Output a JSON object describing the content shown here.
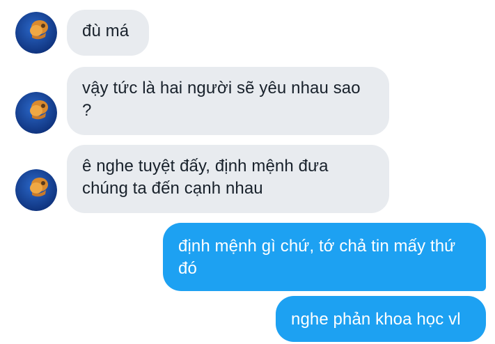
{
  "conversation": {
    "messages": [
      {
        "direction": "incoming",
        "text": "đù má"
      },
      {
        "direction": "incoming",
        "text": "vậy tức là hai người sẽ yêu nhau sao ?"
      },
      {
        "direction": "incoming",
        "text": "ê nghe tuyệt đấy, định mệnh đưa chúng ta đến cạnh nhau"
      },
      {
        "direction": "outgoing",
        "text": "định mệnh gì chứ, tớ chả tin mấy thứ đó"
      },
      {
        "direction": "outgoing",
        "text": "nghe phản khoa học vl"
      }
    ]
  },
  "colors": {
    "incoming_bubble": "#e8ebef",
    "outgoing_bubble": "#1da1f2",
    "avatar_background": "#1f4fa8"
  }
}
